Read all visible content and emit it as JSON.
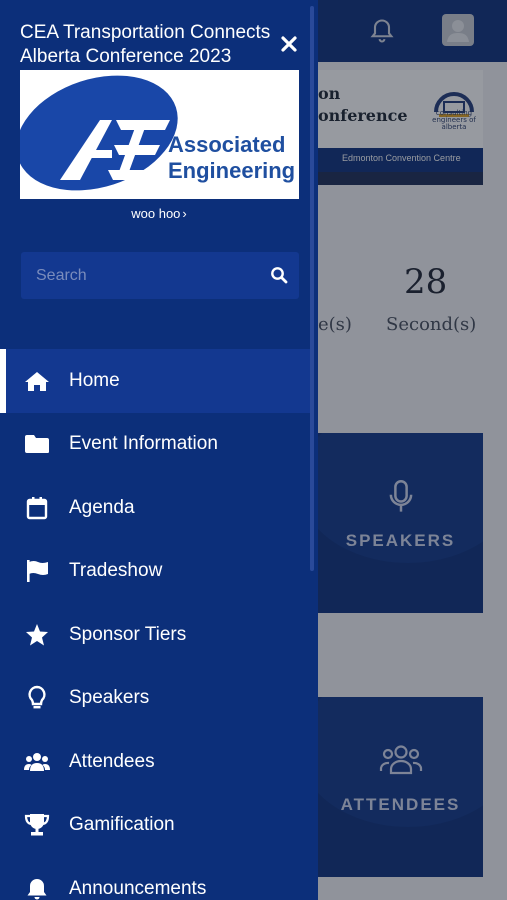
{
  "background": {
    "banner": {
      "title_line1": "on",
      "title_line2": "onference",
      "logo_text": "consulting engineers of alberta",
      "venue": "Edmonton Convention Centre"
    },
    "countdown": {
      "seconds_value": "28",
      "minutes_label_partial": "e(s)",
      "seconds_label": "Second(s)"
    },
    "tiles": [
      {
        "label": "SPEAKERS",
        "icon": "microphone-icon"
      },
      {
        "label": "ATTENDEES",
        "icon": "users-icon"
      }
    ]
  },
  "drawer": {
    "event_title": "CEA Transportation Connects Alberta Conference 2023",
    "sponsor": {
      "name_line1": "Associated",
      "name_line2": "Engineering",
      "link_label": "woo hoo"
    },
    "search": {
      "placeholder": "Search"
    },
    "nav": [
      {
        "label": "Home",
        "icon": "home-icon",
        "active": true
      },
      {
        "label": "Event Information",
        "icon": "folder-icon"
      },
      {
        "label": "Agenda",
        "icon": "calendar-icon"
      },
      {
        "label": "Tradeshow",
        "icon": "flag-icon"
      },
      {
        "label": "Sponsor Tiers",
        "icon": "star-icon"
      },
      {
        "label": "Speakers",
        "icon": "lightbulb-icon"
      },
      {
        "label": "Attendees",
        "icon": "users-icon"
      },
      {
        "label": "Gamification",
        "icon": "trophy-icon"
      },
      {
        "label": "Announcements",
        "icon": "bell-icon"
      }
    ]
  },
  "colors": {
    "drawer_bg": "#0c2f7a",
    "active_item_bg": "#133890",
    "brand_blue": "#1f4fa0"
  }
}
